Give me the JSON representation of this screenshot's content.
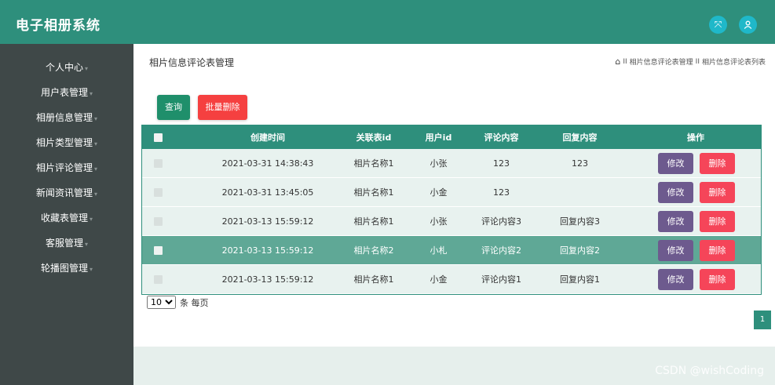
{
  "header": {
    "title": "电子相册系统",
    "icons": [
      "expand-icon",
      "user-icon"
    ]
  },
  "sidebar": {
    "items": [
      {
        "label": "个人中心"
      },
      {
        "label": "用户表管理"
      },
      {
        "label": "相册信息管理"
      },
      {
        "label": "相片类型管理"
      },
      {
        "label": "相片评论管理"
      },
      {
        "label": "新闻资讯管理"
      },
      {
        "label": "收藏表管理"
      },
      {
        "label": "客服管理"
      },
      {
        "label": "轮播图管理"
      }
    ]
  },
  "main": {
    "page_title": "相片信息评论表管理",
    "breadcrumb": [
      "相片信息评论表管理",
      "相片信息评论表列表"
    ],
    "breadcrumb_sep": "II",
    "buttons": {
      "search": "查询",
      "batch_delete": "批量删除"
    }
  },
  "table": {
    "columns": [
      "创建时间",
      "关联表id",
      "用户id",
      "评论内容",
      "回复内容",
      "操作"
    ],
    "rows": [
      {
        "time": "2021-03-31 14:38:43",
        "rel": "相片名称1",
        "user": "小张",
        "comment": "123",
        "reply": "123",
        "highlighted": false
      },
      {
        "time": "2021-03-31 13:45:05",
        "rel": "相片名称1",
        "user": "小金",
        "comment": "123",
        "reply": "",
        "highlighted": false
      },
      {
        "time": "2021-03-13 15:59:12",
        "rel": "相片名称1",
        "user": "小张",
        "comment": "评论内容3",
        "reply": "回复内容3",
        "highlighted": false
      },
      {
        "time": "2021-03-13 15:59:12",
        "rel": "相片名称2",
        "user": "小札",
        "comment": "评论内容2",
        "reply": "回复内容2",
        "highlighted": true
      },
      {
        "time": "2021-03-13 15:59:12",
        "rel": "相片名称1",
        "user": "小金",
        "comment": "评论内容1",
        "reply": "回复内容1",
        "highlighted": false
      }
    ],
    "actions": {
      "edit": "修改",
      "delete": "删除"
    }
  },
  "pagination": {
    "page_size": "10",
    "page_size_suffix": "条 每页",
    "current_page": "1"
  },
  "watermark": "CSDN @wishCoding",
  "colors": {
    "primary": "#2e8f7c",
    "sidebar": "#3f4848",
    "danger": "#f54040",
    "edit": "#6d5a8e",
    "highlight_row": "#5fa896"
  }
}
